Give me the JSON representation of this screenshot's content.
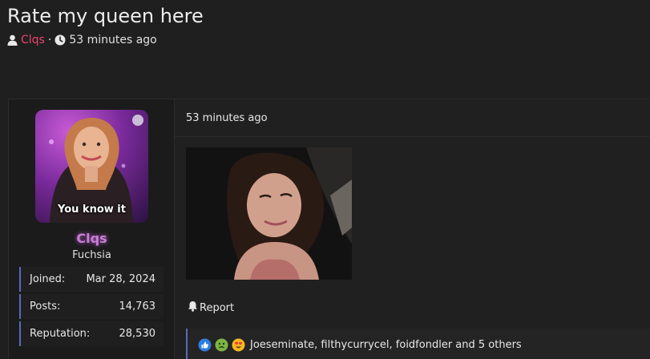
{
  "thread": {
    "title": "Rate my queen here",
    "author": "Clqs",
    "separator": "·",
    "posted": "53 minutes ago"
  },
  "sidebar": {
    "avatar_caption": "You know it",
    "username": "Clqs",
    "usergroup": "Fuchsia",
    "stats": [
      {
        "label": "Joined:",
        "value": "Mar 28, 2024"
      },
      {
        "label": "Posts:",
        "value": "14,763"
      },
      {
        "label": "Reputation:",
        "value": "28,530"
      }
    ]
  },
  "post": {
    "date": "53 minutes ago",
    "report_label": "Report",
    "reactions_text": "Joeseminate, filthycurrycel, foidfondler and 5 others"
  },
  "icons": {
    "user": "user-icon",
    "clock": "clock-icon",
    "bell": "bell-icon",
    "like": "like-reaction-icon",
    "sick": "sick-reaction-icon",
    "love": "heart-eyes-reaction-icon"
  },
  "colors": {
    "background": "#1f1f1f",
    "author_link": "#e8456f",
    "username": "#c97fd6",
    "accent_border": "#5b6ab8"
  }
}
